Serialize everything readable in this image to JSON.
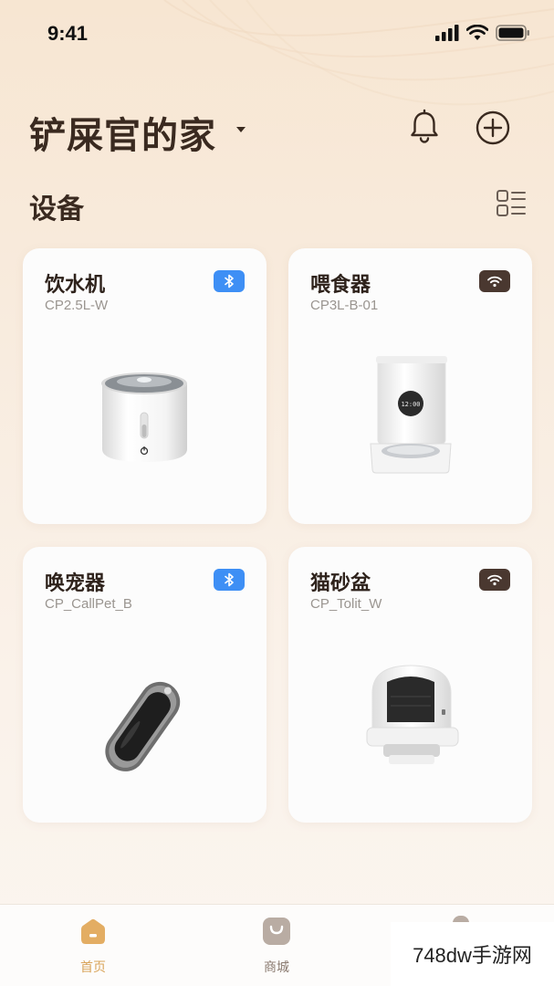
{
  "status_bar": {
    "time": "9:41"
  },
  "header": {
    "home_name": "铲屎官的家"
  },
  "section": {
    "title": "设备"
  },
  "devices": [
    {
      "name": "饮水机",
      "model": "CP2.5L-W",
      "connection": "bluetooth-icon"
    },
    {
      "name": "喂食器",
      "model": "CP3L-B-01",
      "connection": "wifi-icon"
    },
    {
      "name": "唤宠器",
      "model": "CP_CallPet_B",
      "connection": "bluetooth-icon"
    },
    {
      "name": "猫砂盆",
      "model": "CP_Tolit_W",
      "connection": "wifi-icon"
    }
  ],
  "feeder_screen": "12:00",
  "tabs": [
    {
      "label": "首页",
      "icon": "home-icon",
      "active": true
    },
    {
      "label": "商城",
      "icon": "shopping-bag-icon",
      "active": false
    }
  ],
  "watermark": "748dw手游网",
  "colors": {
    "accent": "#d9a45a",
    "bluetooth_badge": "#3e8ff5",
    "wifi_badge": "#4a3830",
    "title_text": "#3a2a20"
  }
}
